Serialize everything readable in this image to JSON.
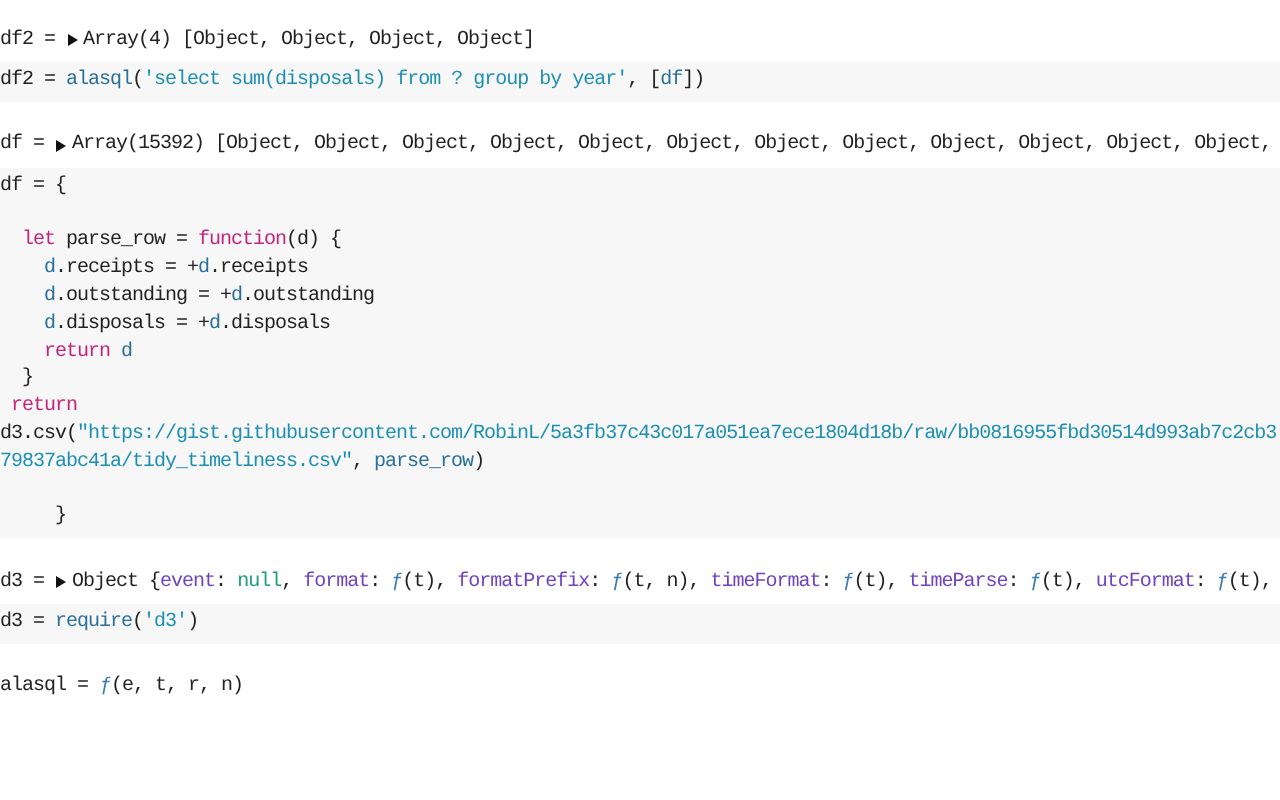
{
  "cells": [
    {
      "output": {
        "label": "df2 =",
        "expanded": false,
        "value": [
          {
            "kind": "plain",
            "text": "Array(4) [Object, Object, Object, Object]"
          }
        ]
      },
      "code": [
        {
          "tokens": [
            {
              "kind": "plain",
              "text": "df2 = "
            },
            {
              "kind": "var",
              "text": "alasql"
            },
            {
              "kind": "plain",
              "text": "("
            },
            {
              "kind": "string",
              "text": "'select sum(disposals) from ? group by year'"
            },
            {
              "kind": "plain",
              "text": ", ["
            },
            {
              "kind": "var",
              "text": "df"
            },
            {
              "kind": "plain",
              "text": "])"
            }
          ]
        }
      ]
    },
    {
      "output": {
        "label": "df =",
        "expanded": false,
        "value": [
          {
            "kind": "plain",
            "text": "Array(15392) [Object, Object, Object, Object, Object, Object, Object, Object, Object, Object, Object, Object,"
          }
        ]
      },
      "code": [
        {
          "tokens": [
            {
              "kind": "plain",
              "text": "df = {"
            }
          ]
        },
        {
          "blank_before": true,
          "tokens": [
            {
              "kind": "keyword",
              "text": "  let"
            },
            {
              "kind": "plain",
              "text": " parse_row = "
            },
            {
              "kind": "keyword",
              "text": "function"
            },
            {
              "kind": "plain",
              "text": "(d) {"
            }
          ]
        },
        {
          "tokens": [
            {
              "kind": "var",
              "text": "    d"
            },
            {
              "kind": "plain",
              "text": ".receipts = +"
            },
            {
              "kind": "var",
              "text": "d"
            },
            {
              "kind": "plain",
              "text": ".receipts"
            }
          ]
        },
        {
          "tokens": [
            {
              "kind": "var",
              "text": "    d"
            },
            {
              "kind": "plain",
              "text": ".outstanding = +"
            },
            {
              "kind": "var",
              "text": "d"
            },
            {
              "kind": "plain",
              "text": ".outstanding"
            }
          ]
        },
        {
          "tokens": [
            {
              "kind": "var",
              "text": "    d"
            },
            {
              "kind": "plain",
              "text": ".disposals = +"
            },
            {
              "kind": "var",
              "text": "d"
            },
            {
              "kind": "plain",
              "text": ".disposals"
            }
          ]
        },
        {
          "tokens": [
            {
              "kind": "keyword",
              "text": "    return "
            },
            {
              "kind": "var",
              "text": "d"
            }
          ]
        },
        {
          "tokens": [
            {
              "kind": "plain",
              "text": "  }"
            }
          ]
        },
        {
          "tokens": [
            {
              "kind": "keyword",
              "text": " return"
            }
          ]
        },
        {
          "tokens": [
            {
              "kind": "plain",
              "text": "d3.csv("
            },
            {
              "kind": "string",
              "text": "\"https://gist.githubusercontent.com/RobinL/5a3fb37c43c017a051ea7ece1804d18b/raw/bb0816955fbd30514d993ab7c2cb3"
            }
          ]
        },
        {
          "tokens": [
            {
              "kind": "string",
              "text": "79837abc41a/tidy_timeliness.csv\""
            },
            {
              "kind": "plain",
              "text": ", "
            },
            {
              "kind": "var",
              "text": "parse_row"
            },
            {
              "kind": "plain",
              "text": ")"
            }
          ]
        },
        {
          "blank_before": true,
          "tokens": [
            {
              "kind": "plain",
              "text": "     }"
            }
          ]
        }
      ]
    },
    {
      "output": {
        "label": "d3 =",
        "expanded": false,
        "value": [
          {
            "kind": "plain",
            "text": "Object {"
          },
          {
            "kind": "prop",
            "text": "event"
          },
          {
            "kind": "plain",
            "text": ": "
          },
          {
            "kind": "null",
            "text": "null"
          },
          {
            "kind": "plain",
            "text": ", "
          },
          {
            "kind": "prop",
            "text": "format"
          },
          {
            "kind": "plain",
            "text": ": "
          },
          {
            "kind": "fn",
            "text": "ƒ"
          },
          {
            "kind": "plain",
            "text": "(t), "
          },
          {
            "kind": "prop",
            "text": "formatPrefix"
          },
          {
            "kind": "plain",
            "text": ": "
          },
          {
            "kind": "fn",
            "text": "ƒ"
          },
          {
            "kind": "plain",
            "text": "(t, n), "
          },
          {
            "kind": "prop",
            "text": "timeFormat"
          },
          {
            "kind": "plain",
            "text": ": "
          },
          {
            "kind": "fn",
            "text": "ƒ"
          },
          {
            "kind": "plain",
            "text": "(t), "
          },
          {
            "kind": "prop",
            "text": "timeParse"
          },
          {
            "kind": "plain",
            "text": ": "
          },
          {
            "kind": "fn",
            "text": "ƒ"
          },
          {
            "kind": "plain",
            "text": "(t), "
          },
          {
            "kind": "prop",
            "text": "utcFormat"
          },
          {
            "kind": "plain",
            "text": ": "
          },
          {
            "kind": "fn",
            "text": "ƒ"
          },
          {
            "kind": "plain",
            "text": "(t),"
          }
        ]
      },
      "code": [
        {
          "tokens": [
            {
              "kind": "plain",
              "text": "d3 = "
            },
            {
              "kind": "var",
              "text": "require"
            },
            {
              "kind": "plain",
              "text": "("
            },
            {
              "kind": "string",
              "text": "'d3'"
            },
            {
              "kind": "plain",
              "text": ")"
            }
          ]
        }
      ]
    },
    {
      "output": {
        "label": "alasql =",
        "value": [
          {
            "kind": "fn",
            "text": "ƒ"
          },
          {
            "kind": "plain",
            "text": "(e, t, r, n)"
          }
        ]
      }
    }
  ]
}
